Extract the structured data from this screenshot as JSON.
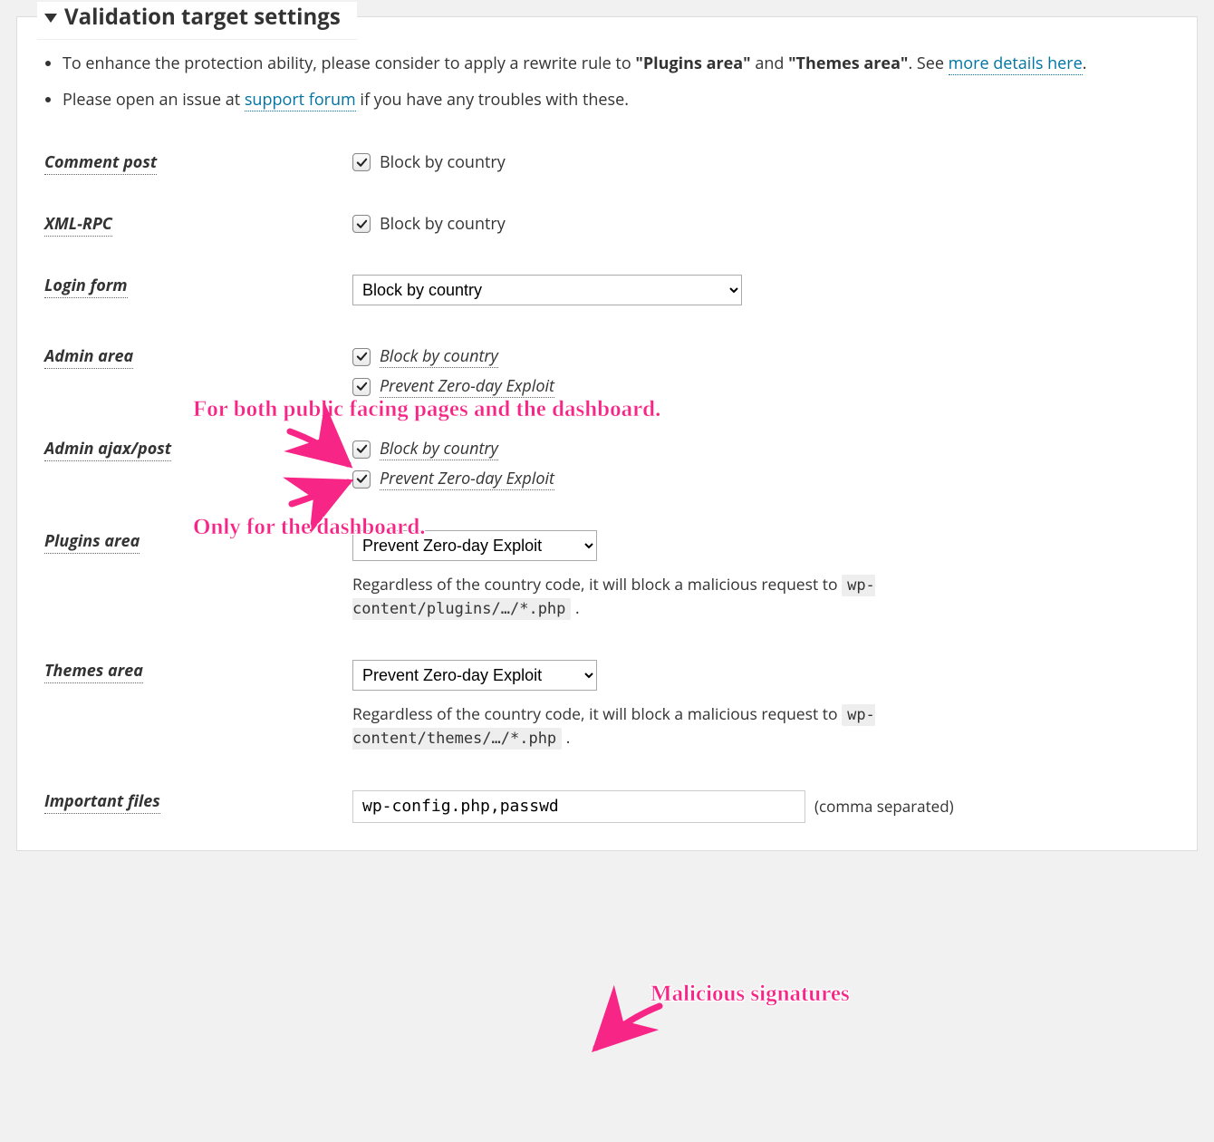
{
  "section": {
    "title": "Validation target settings"
  },
  "bullets": {
    "b1_pre": "To enhance the protection ability, please consider to apply a rewrite rule to ",
    "b1_q1": "\"Plugins area\"",
    "b1_mid": " and ",
    "b1_q2": "\"Themes area\"",
    "b1_post1": ". See ",
    "b1_link": "more details here",
    "b1_post2": ".",
    "b2_pre": "Please open an issue at ",
    "b2_link": "support forum",
    "b2_post": " if you have any troubles with these."
  },
  "labels": {
    "comment_post": "Comment post",
    "xml_rpc": "XML-RPC",
    "login_form": "Login form",
    "admin_area": "Admin area",
    "admin_ajax": "Admin ajax/post",
    "plugins_area": "Plugins area",
    "themes_area": "Themes area",
    "important_files": "Important files"
  },
  "options": {
    "block_by_country": "Block by country",
    "prevent_zeroday": "Prevent Zero-day Exploit"
  },
  "login_form_select": "Block by country",
  "plugins_select": "Prevent Zero-day Exploit",
  "themes_select": "Prevent Zero-day Exploit",
  "plugins_desc_pre": "Regardless of the country code, it will block a malicious request to ",
  "plugins_code": "wp-content/plugins/…/*.php",
  "themes_desc_pre": "Regardless of the country code, it will block a malicious request to ",
  "themes_code": "wp-content/themes/…/*.php",
  "important_files_value": "wp-config.php,passwd",
  "important_files_hint": "(comma separated)",
  "annotations": {
    "a1": "For both public facing pages and the dashboard.",
    "a2": "Only for the dashboard.",
    "a3": "Malicious signatures"
  }
}
